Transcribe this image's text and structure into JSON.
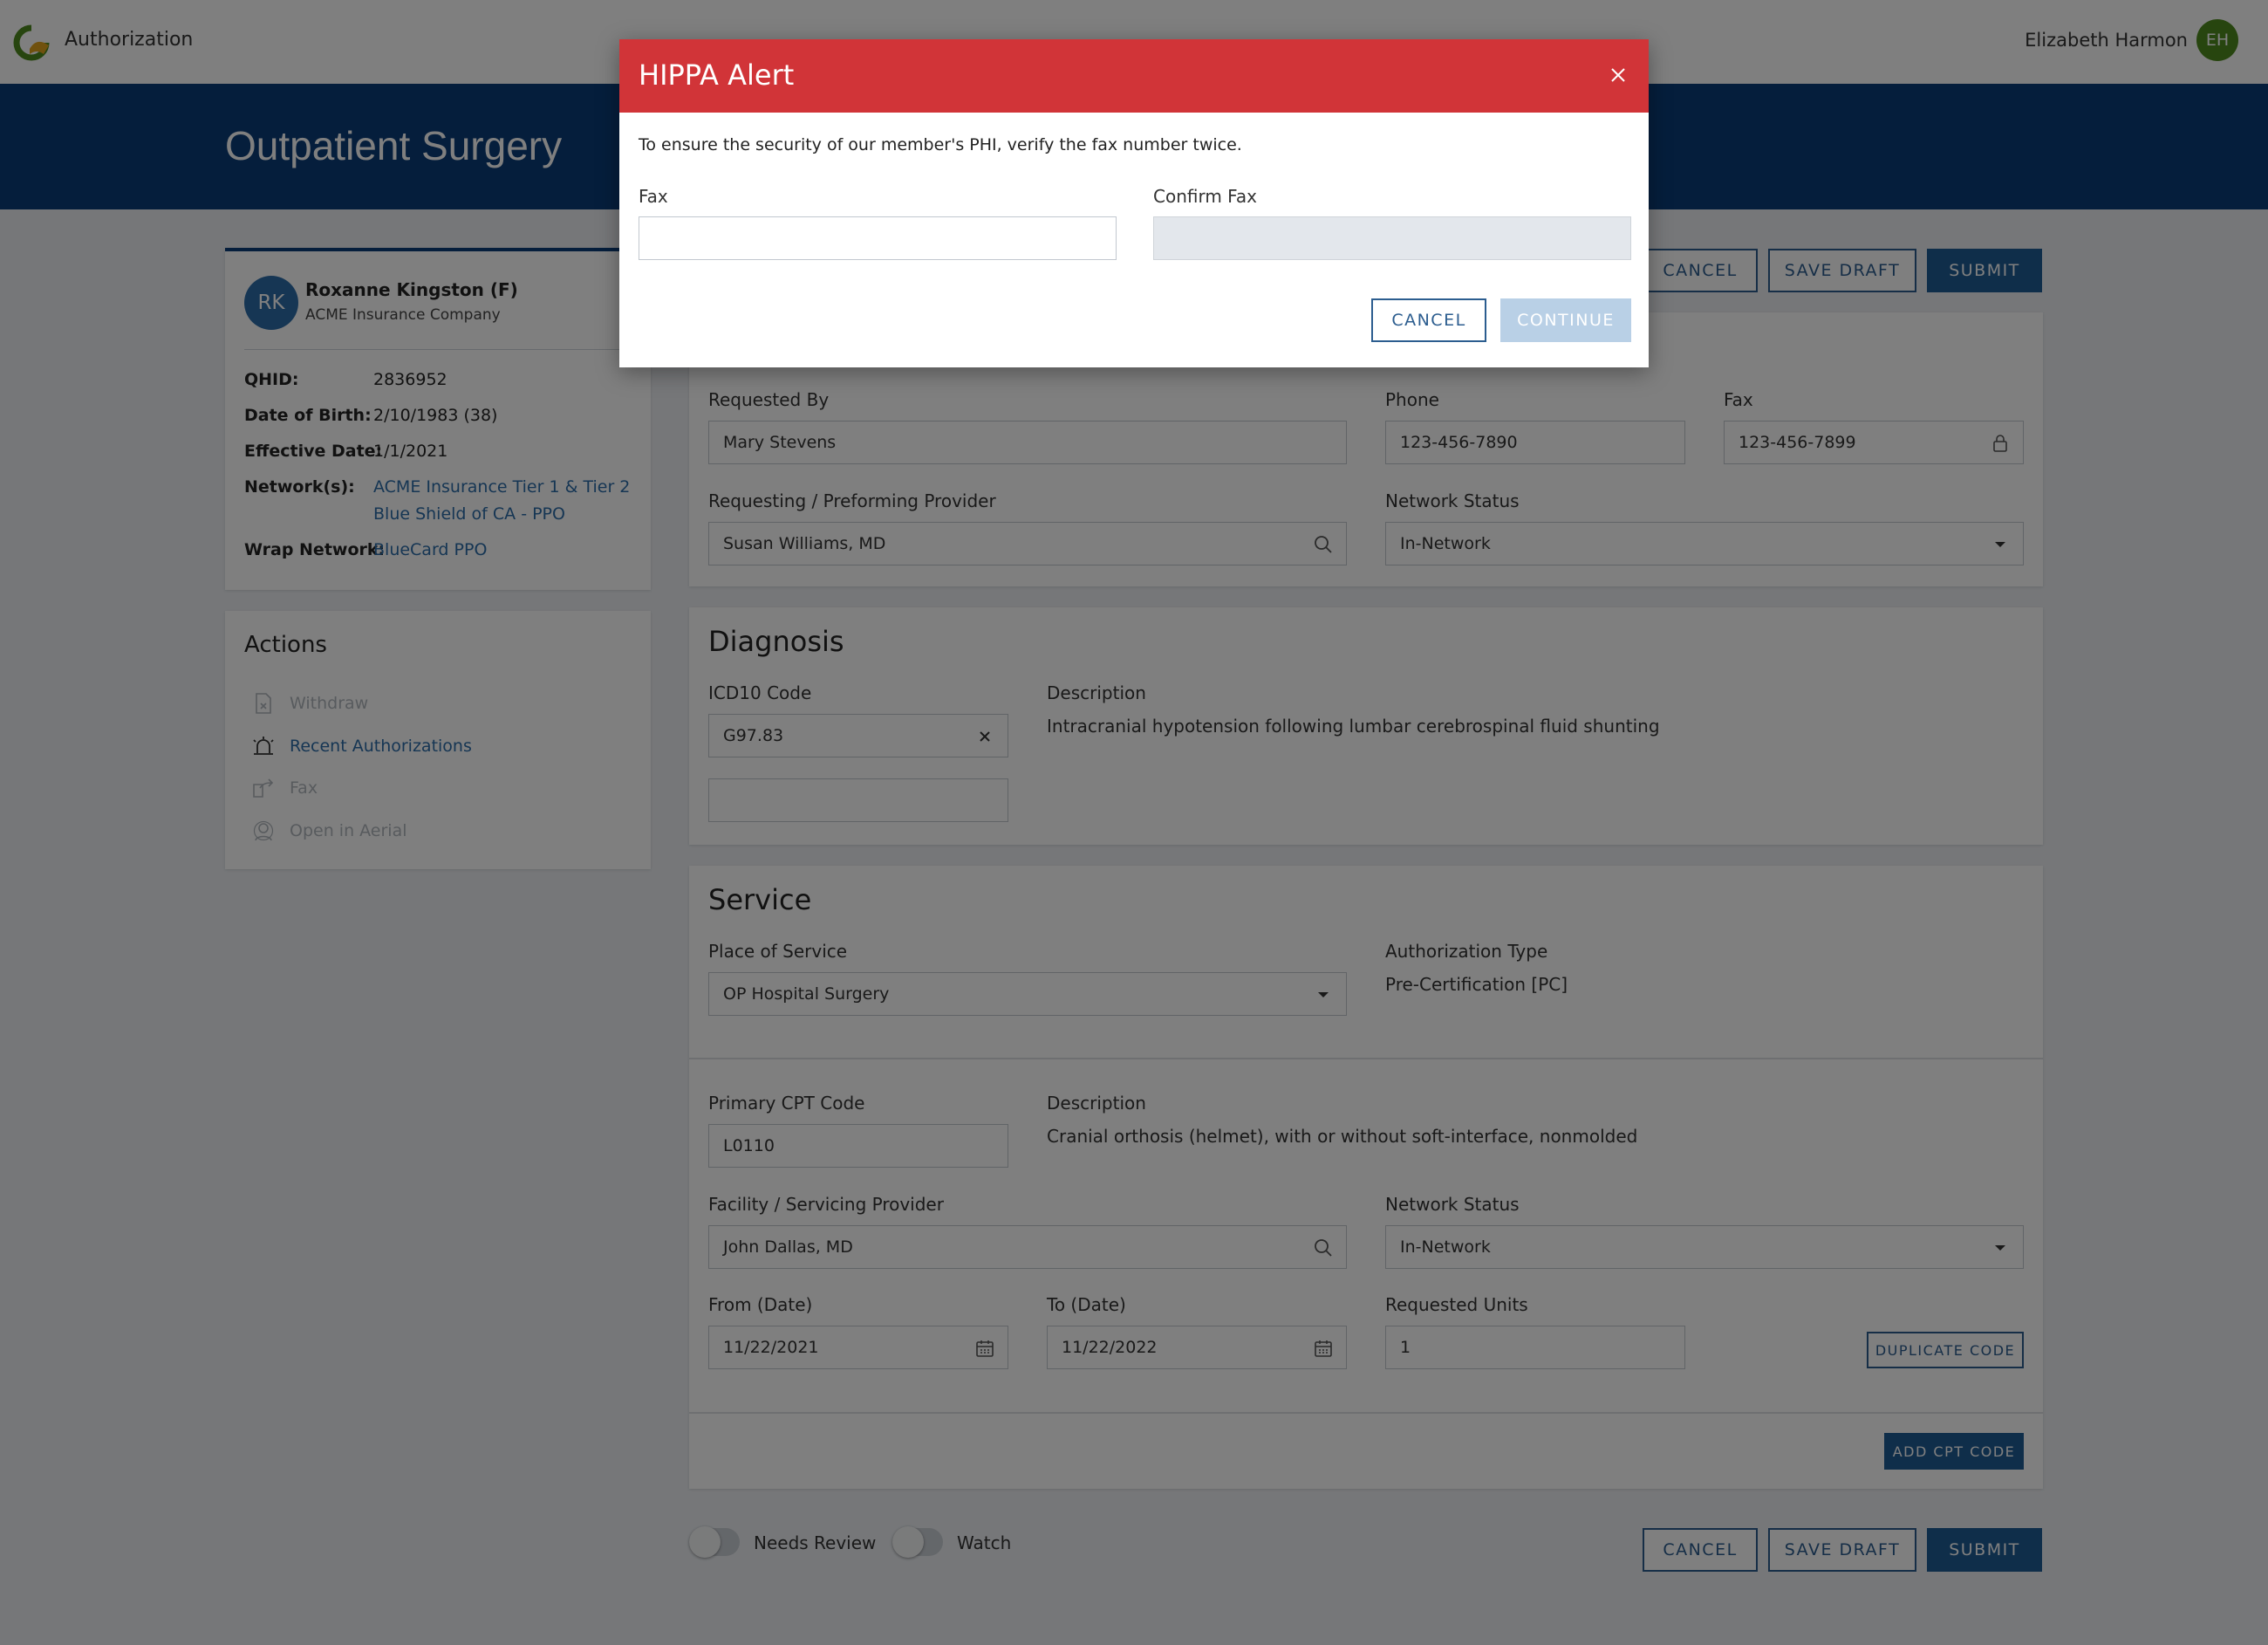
{
  "app": {
    "title": "Authorization",
    "logo_icon": "app-logo-icon"
  },
  "user": {
    "name": "Elizabeth Harmon",
    "initials": "EH",
    "avatar_color": "#4f8a1f"
  },
  "page": {
    "title": "Outpatient Surgery"
  },
  "member": {
    "initials": "RK",
    "name": "Roxanne Kingston (F)",
    "company": "ACME Insurance Company",
    "fields": {
      "qhid_label": "QHID:",
      "qhid": "2836952",
      "dob_label": "Date of Birth:",
      "dob": "2/10/1983 (38)",
      "effective_label": "Effective Date:",
      "effective": "1/1/2021",
      "networks_label": "Network(s):",
      "network_1": "ACME Insurance Tier 1 & Tier 2",
      "network_2": "Blue Shield of CA - PPO",
      "wrap_label": "Wrap Network:",
      "wrap": "BlueCard PPO"
    }
  },
  "actions": {
    "title": "Actions",
    "items": [
      {
        "label": "Withdraw",
        "icon": "withdraw-document-icon",
        "enabled": false
      },
      {
        "label": "Recent Authorizations",
        "icon": "siren-alarm-icon",
        "enabled": true
      },
      {
        "label": "Fax",
        "icon": "fax-share-icon",
        "enabled": false
      },
      {
        "label": "Open in Aerial",
        "icon": "aerial-person-icon",
        "enabled": false
      }
    ]
  },
  "toolbar": {
    "cancel": "CANCEL",
    "save_draft": "SAVE DRAFT",
    "submit": "SUBMIT"
  },
  "request": {
    "requested_by_label": "Requested By",
    "requested_by": "Mary Stevens",
    "phone_label": "Phone",
    "phone": "123-456-7890",
    "fax_label": "Fax",
    "fax": "123-456-7899",
    "provider_label": "Requesting / Preforming Provider",
    "provider": "Susan Williams, MD",
    "network_status_label": "Network Status",
    "network_status": "In-Network"
  },
  "diagnosis": {
    "title": "Diagnosis",
    "code_label": "ICD10 Code",
    "code": "G97.83",
    "description_label": "Description",
    "description": "Intracranial hypotension following lumbar cerebrospinal fluid shunting"
  },
  "service": {
    "title": "Service",
    "place_label": "Place of Service",
    "place": "OP Hospital Surgery",
    "auth_type_label": "Authorization Type",
    "auth_type": "Pre-Certification [PC]",
    "cpt_label": "Primary CPT Code",
    "cpt": "L0110",
    "cpt_description_label": "Description",
    "cpt_description": "Cranial orthosis (helmet), with or without soft-interface, nonmolded",
    "facility_label": "Facility / Servicing Provider",
    "facility": "John Dallas, MD",
    "network_status_label": "Network Status",
    "network_status": "In-Network",
    "from_label": "From (Date)",
    "from": "11/22/2021",
    "to_label": "To (Date)",
    "to": "11/22/2022",
    "units_label": "Requested Units",
    "units": "1",
    "duplicate_code": "DUPLICATE CODE",
    "add_cpt_code": "ADD CPT CODE"
  },
  "toggles": {
    "needs_review": "Needs Review",
    "watch": "Watch"
  },
  "modal": {
    "title": "HIPPA Alert",
    "message": "To ensure the security of our member's PHI, verify the fax number twice.",
    "fax_label": "Fax",
    "fax_value": "",
    "confirm_label": "Confirm Fax",
    "confirm_value": "",
    "cancel": "CANCEL",
    "continue": "CONTINUE",
    "header_color": "#d13438"
  },
  "colors": {
    "brand_navy": "#0b3c78",
    "primary": "#1f5c94",
    "link": "#2c6ca8",
    "alert": "#d13438"
  }
}
